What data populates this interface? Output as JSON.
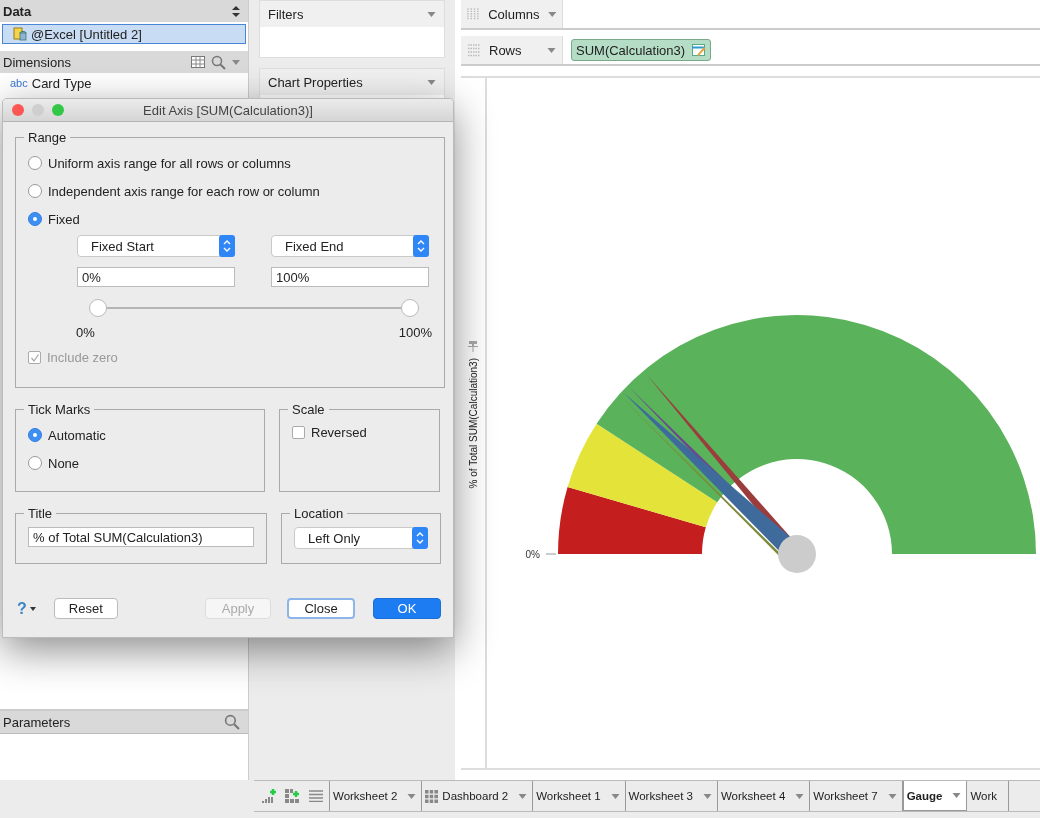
{
  "data_pane": {
    "title": "Data",
    "source": {
      "label": "@Excel [Untitled 2]",
      "selected": true
    }
  },
  "dimensions": {
    "title": "Dimensions",
    "items": [
      {
        "type_badge": "abc",
        "label": "Card Type"
      }
    ]
  },
  "parameters": {
    "title": "Parameters"
  },
  "filters": {
    "title": "Filters"
  },
  "chart_properties": {
    "title": "Chart Properties"
  },
  "columns_shelf": {
    "label": "Columns"
  },
  "rows_shelf": {
    "label": "Rows",
    "pill": "SUM(Calculation3)"
  },
  "view": {
    "axis_title": "% of Total SUM(Calculation3)",
    "axis_tick": "0%"
  },
  "dialog": {
    "title": "Edit Axis [SUM(Calculation3)]",
    "range": {
      "legend": "Range",
      "options": [
        {
          "label": "Uniform axis range for all rows or columns",
          "selected": false
        },
        {
          "label": "Independent axis range for each row or column",
          "selected": false
        },
        {
          "label": "Fixed",
          "selected": true
        }
      ],
      "start_select": "Fixed Start",
      "end_select": "Fixed End",
      "start_value": "0%",
      "end_value": "100%",
      "slider_min_label": "0%",
      "slider_max_label": "100%",
      "slider_thumbs": [
        {
          "level": 0
        },
        {
          "level": 1
        }
      ],
      "include_zero": {
        "label": "Include zero",
        "checked": true,
        "disabled": true
      }
    },
    "tick_marks": {
      "legend": "Tick Marks",
      "options": [
        {
          "label": "Automatic",
          "selected": true
        },
        {
          "label": "None",
          "selected": false
        }
      ]
    },
    "scale": {
      "legend": "Scale",
      "reversed": {
        "label": "Reversed",
        "checked": false
      }
    },
    "title_group": {
      "legend": "Title",
      "value": "% of Total SUM(Calculation3)"
    },
    "location": {
      "legend": "Location",
      "value": "Left Only"
    },
    "help": "?",
    "buttons": [
      {
        "label": "Reset",
        "kind": "normal"
      },
      {
        "label": "Apply",
        "kind": "disabled"
      },
      {
        "label": "Close",
        "kind": "focused"
      },
      {
        "label": "OK",
        "kind": "default"
      }
    ]
  },
  "sheet_tabs": [
    {
      "label": "Worksheet 2",
      "kind": "worksheet",
      "selected": false
    },
    {
      "label": "Dashboard 2",
      "kind": "dashboard",
      "selected": false
    },
    {
      "label": "Worksheet 1",
      "kind": "worksheet",
      "selected": false
    },
    {
      "label": "Worksheet 3",
      "kind": "worksheet",
      "selected": false
    },
    {
      "label": "Worksheet 4",
      "kind": "worksheet",
      "selected": false
    },
    {
      "label": "Worksheet 7",
      "kind": "worksheet",
      "selected": false
    },
    {
      "label": "Gauge",
      "kind": "worksheet",
      "selected": true
    },
    {
      "label": "Work",
      "kind": "cut",
      "selected": false
    }
  ]
}
